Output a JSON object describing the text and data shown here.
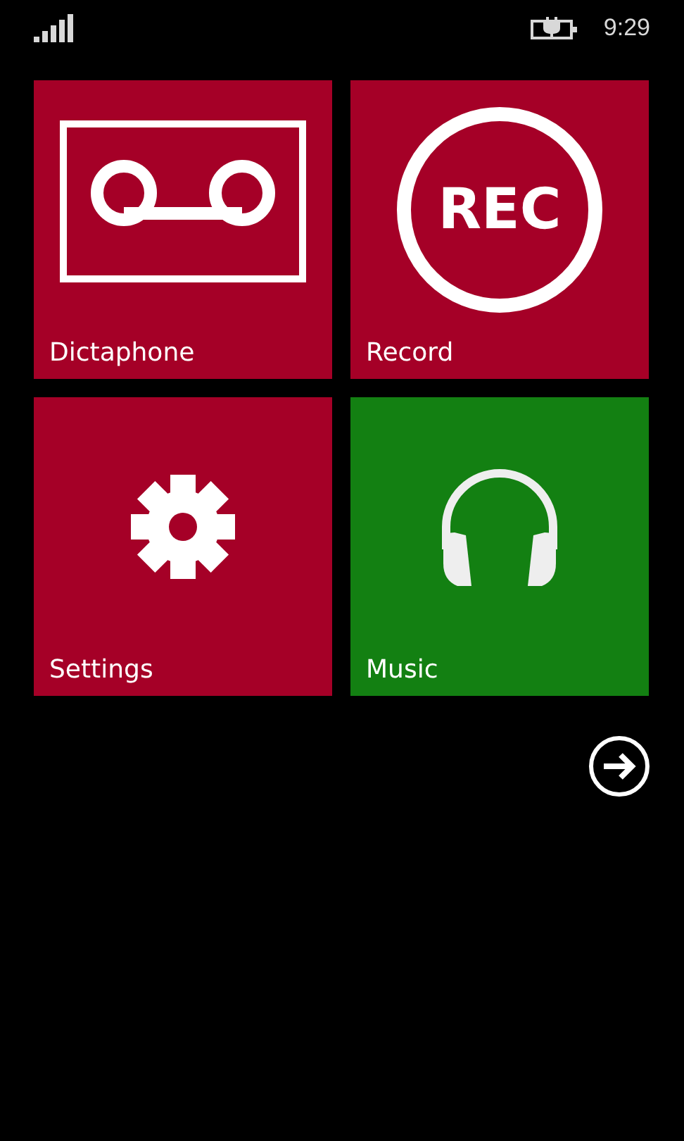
{
  "status_bar": {
    "time": "9:29"
  },
  "tiles": [
    {
      "kind": "dictaphone",
      "label": "Dictaphone",
      "color": "#a50027"
    },
    {
      "kind": "record",
      "label": "Record",
      "color": "#a50027"
    },
    {
      "kind": "settings",
      "label": "Settings",
      "color": "#a50027"
    },
    {
      "kind": "music",
      "label": "Music",
      "color": "#138012"
    }
  ],
  "record_icon": {
    "text": "REC"
  }
}
